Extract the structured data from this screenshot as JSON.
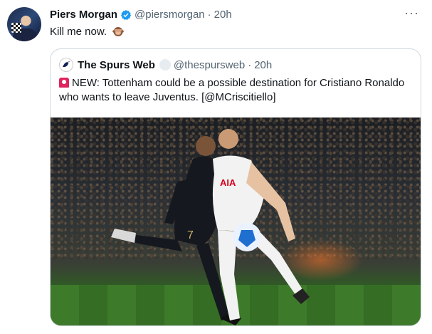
{
  "tweet": {
    "author_name": "Piers Morgan",
    "author_handle": "@piersmorgan",
    "separator": "·",
    "time": "20h",
    "text": "Kill me now.",
    "emoji": "see-no-evil-monkey",
    "more_label": "···"
  },
  "quoted": {
    "author_name": "The Spurs Web",
    "author_handle": "@thespursweb",
    "separator": "·",
    "time": "20h",
    "text": "NEW: Tottenham could be a possible destination for Cristiano Ronaldo who wants to leave Juventus. [@MCriscitiello]",
    "media_description": ""
  },
  "icons": {
    "verified": "verified-badge-icon",
    "more": "more-icon",
    "siren": "siren-emoji-icon",
    "monkey": "see-no-evil-monkey-icon"
  },
  "colors": {
    "text": "#0f1419",
    "secondary": "#536471",
    "verified_blue": "#1d9bf0",
    "border": "#cfd9de"
  }
}
